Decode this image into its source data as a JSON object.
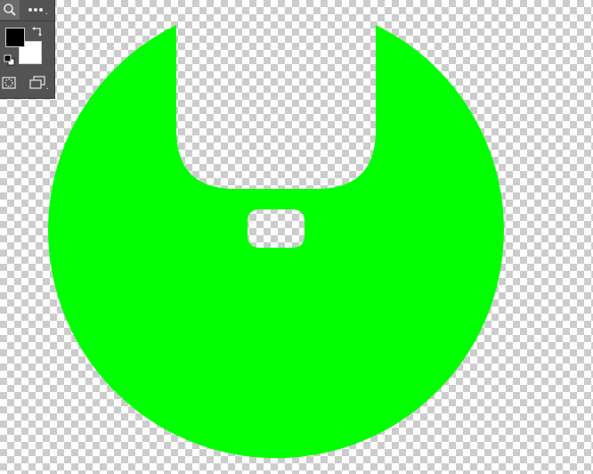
{
  "canvas": {
    "background": "transparent-checkerboard"
  },
  "artwork": {
    "shape": "circle-with-top-notch-and-rounded-slot",
    "fill_color": "#00ff00"
  },
  "toolbar": {
    "background_color": "#535353",
    "tools": [
      {
        "id": "zoom",
        "icon": "magnifier-icon"
      },
      {
        "id": "more",
        "icon": "more-icon"
      },
      {
        "id": "swap-colors",
        "icon": "swap-arrows-icon"
      },
      {
        "id": "default-colors",
        "icon": "default-colors-icon"
      },
      {
        "id": "quick-mask",
        "icon": "quick-mask-icon"
      },
      {
        "id": "screen-mode",
        "icon": "screen-mode-icon"
      }
    ],
    "foreground_color": "#000000",
    "background_swatch_color": "#ffffff"
  }
}
